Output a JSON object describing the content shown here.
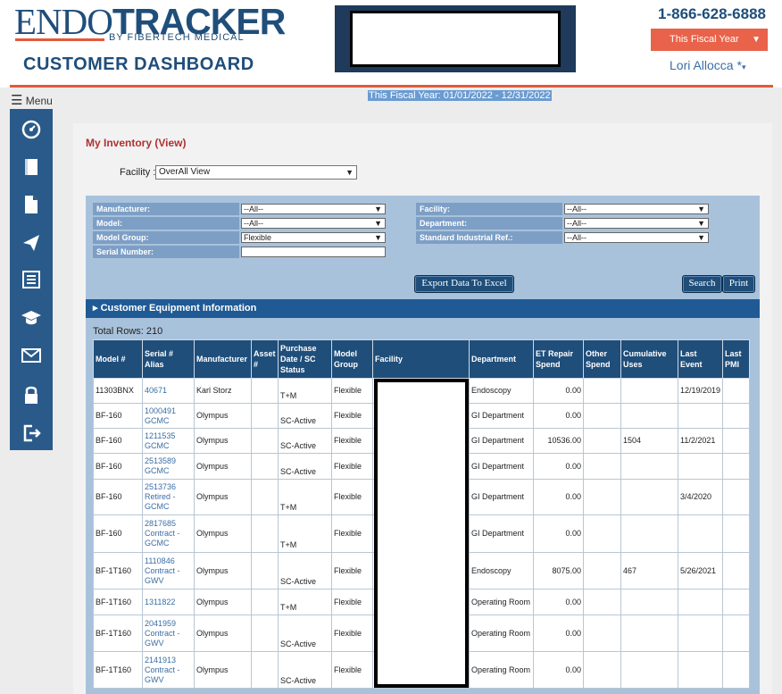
{
  "header": {
    "logo_part1": "ENDO",
    "logo_part2": "TRACKER",
    "logo_sub": "BY FIBERTECH MEDICAL",
    "title": "CUSTOMER DASHBOARD",
    "phone": "1-866-628-6888",
    "fiscal_button": "This Fiscal Year",
    "user": "Lori Allocca *"
  },
  "menu_label": "Menu",
  "sidebar": {
    "icons": [
      "dashboard-icon",
      "book-icon",
      "document-icon",
      "send-icon",
      "list-icon",
      "graduation-cap-icon",
      "mail-icon",
      "lock-icon",
      "logout-icon"
    ]
  },
  "fiscal_note": "This Fiscal Year: 01/01/2022 - 12/31/2022",
  "panel": {
    "title": "My Inventory (View)",
    "facility_label": "Facility :",
    "facility_value": "OverAll View"
  },
  "filters": {
    "left": [
      {
        "label": "Manufacturer:",
        "value": "--All--"
      },
      {
        "label": "Model:",
        "value": "--All--"
      },
      {
        "label": "Model Group:",
        "value": "Flexible"
      },
      {
        "label": "Serial Number:",
        "value": ""
      }
    ],
    "right": [
      {
        "label": "Facility:",
        "value": "--All--"
      },
      {
        "label": "Department:",
        "value": "--All--"
      },
      {
        "label": "Standard Industrial Ref.:",
        "value": "--All--"
      }
    ],
    "export_label": "Export Data To Excel",
    "search_label": "Search",
    "print_label": "Print"
  },
  "section_title": "Customer Equipment Information",
  "total_rows": "Total Rows: 210",
  "table": {
    "headers": [
      "Model #",
      "Serial # Alias",
      "Manufacturer",
      "Asset #",
      "Purchase Date / SC Status",
      "Model Group",
      "Facility",
      "Department",
      "ET Repair Spend",
      "Other Spend",
      "Cumulative Uses",
      "Last Event",
      "Last PMI"
    ],
    "rows": [
      [
        "11303BNX",
        "40671",
        "Karl Storz",
        "",
        "T+M",
        "Flexible",
        "",
        "Endoscopy",
        "0.00",
        "",
        "",
        "12/19/2019",
        ""
      ],
      [
        "BF-160",
        "1000491 GCMC",
        "Olympus",
        "",
        "SC-Active",
        "Flexible",
        "",
        "GI Department",
        "0.00",
        "",
        "",
        "",
        ""
      ],
      [
        "BF-160",
        "1211535 GCMC",
        "Olympus",
        "",
        "SC-Active",
        "Flexible",
        "",
        "GI Department",
        "10536.00",
        "",
        "1504",
        "11/2/2021",
        ""
      ],
      [
        "BF-160",
        "2513589 GCMC",
        "Olympus",
        "",
        "SC-Active",
        "Flexible",
        "",
        "GI Department",
        "0.00",
        "",
        "",
        "",
        ""
      ],
      [
        "BF-160",
        "2513736 Retired - GCMC",
        "Olympus",
        "",
        "T+M",
        "Flexible",
        "",
        "GI Department",
        "0.00",
        "",
        "",
        "3/4/2020",
        ""
      ],
      [
        "BF-160",
        "2817685 Contract - GCMC",
        "Olympus",
        "",
        "T+M",
        "Flexible",
        "",
        "GI Department",
        "0.00",
        "",
        "",
        "",
        ""
      ],
      [
        "BF-1T160",
        "1110846 Contract - GWV",
        "Olympus",
        "",
        "SC-Active",
        "Flexible",
        "",
        "Endoscopy",
        "8075.00",
        "",
        "467",
        "5/26/2021",
        ""
      ],
      [
        "BF-1T160",
        "1311822",
        "Olympus",
        "",
        "T+M",
        "Flexible",
        "",
        "Operating Room",
        "0.00",
        "",
        "",
        "",
        ""
      ],
      [
        "BF-1T160",
        "2041959 Contract - GWV",
        "Olympus",
        "",
        "SC-Active",
        "Flexible",
        "",
        "Operating Room",
        "0.00",
        "",
        "",
        "",
        ""
      ],
      [
        "BF-1T160",
        "2141913 Contract - GWV",
        "Olympus",
        "",
        "SC-Active",
        "Flexible",
        "",
        "Operating Room",
        "0.00",
        "",
        "",
        "",
        ""
      ]
    ]
  },
  "colors": {
    "brand_blue": "#1f4e7a",
    "accent_orange": "#e8634a",
    "link_blue": "#3a6ea5",
    "title_red": "#b03030"
  }
}
